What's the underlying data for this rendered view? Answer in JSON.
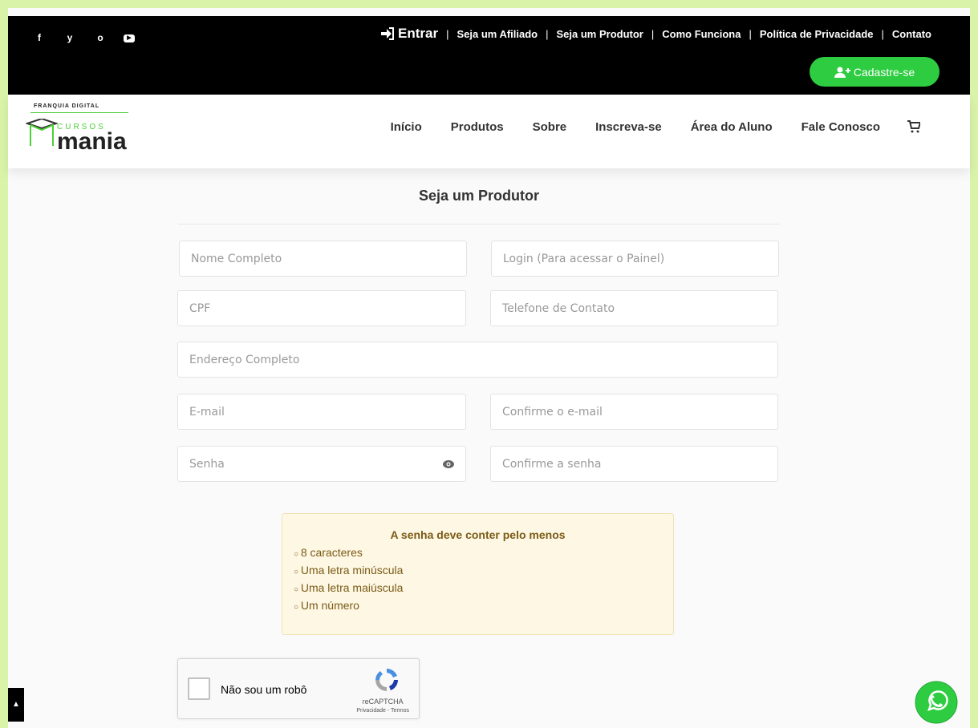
{
  "topbar": {
    "social": [
      "f",
      "y",
      "o",
      "▶"
    ],
    "entrar": "Entrar",
    "links": [
      "Seja um Afiliado",
      "Seja um Produtor",
      "Como Funciona",
      "Política de Privacidade",
      "Contato"
    ],
    "cadastre": "Cadastre-se"
  },
  "logo": {
    "tag": "FRANQUIA DIGITAL",
    "cursos": "CURSOS",
    "mania": "mania"
  },
  "nav": [
    "Início",
    "Produtos",
    "Sobre",
    "Inscreva-se",
    "Área do Aluno",
    "Fale Conosco"
  ],
  "form": {
    "title": "Seja um Produtor",
    "fields": {
      "nome": "Nome Completo",
      "login": "Login (Para acessar o Painel)",
      "cpf": "CPF",
      "telefone": "Telefone de Contato",
      "endereco": "Endereço Completo",
      "email": "E-mail",
      "confirm_email": "Confirme o e-mail",
      "senha": "Senha",
      "confirm_senha": "Confirme a senha"
    }
  },
  "password_rules": {
    "title": "A senha deve conter pelo menos",
    "items": [
      "8 caracteres",
      "Uma letra minúscula",
      "Uma letra maiúscula",
      "Um número"
    ]
  },
  "captcha": {
    "label": "Não sou um robô",
    "brand": "reCAPTCHA",
    "links": "Privacidade - Termos"
  },
  "colors": {
    "accent": "#2ecc40",
    "topbar": "#000000",
    "frame": "#d9f3a8"
  }
}
